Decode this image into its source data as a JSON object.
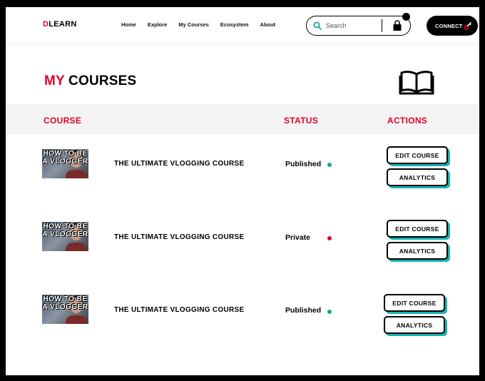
{
  "header": {
    "logo_letter": "D",
    "logo_rest": "LEARN",
    "nav": [
      "Home",
      "Explore",
      "My Courses",
      "Ecosystem",
      "About"
    ],
    "search_placeholder": "Search",
    "connect_label": "CONNECT"
  },
  "title": {
    "part1": "MY",
    "part2": "COURSES"
  },
  "table": {
    "headers": {
      "course": "COURSE",
      "status": "STATUS",
      "actions": "ACTIONS"
    },
    "rows": [
      {
        "thumb_text": "HOW TO BE A VLOGGER",
        "name": "THE ULTIMATE VLOGGING COURSE",
        "status": "Published",
        "status_color": "#1aa39b",
        "edit_label": "EDIT COURSE",
        "analytics_label": "ANALYTICS"
      },
      {
        "thumb_text": "HOW TO BE A VLOGGER",
        "name": "THE ULTIMATE VLOGGING COURSE",
        "status": "Private",
        "status_color": "#e4002b",
        "edit_label": "EDIT COURSE",
        "analytics_label": "ANALYTICS"
      },
      {
        "thumb_text": "HOW TO BE A VLOGGER",
        "name": "THE ULTIMATE VLOGGING COURSE",
        "status": "Published",
        "status_color": "#1aa39b",
        "edit_label": "EDIT COURSE",
        "analytics_label": "ANALYTICS"
      }
    ]
  },
  "colors": {
    "accent": "#e4002b",
    "shadow": "#18b3b3"
  },
  "icons": {
    "search": "search-icon",
    "cart": "shopping-bag-icon",
    "connect": "key-icon",
    "title": "open-book-icon"
  }
}
